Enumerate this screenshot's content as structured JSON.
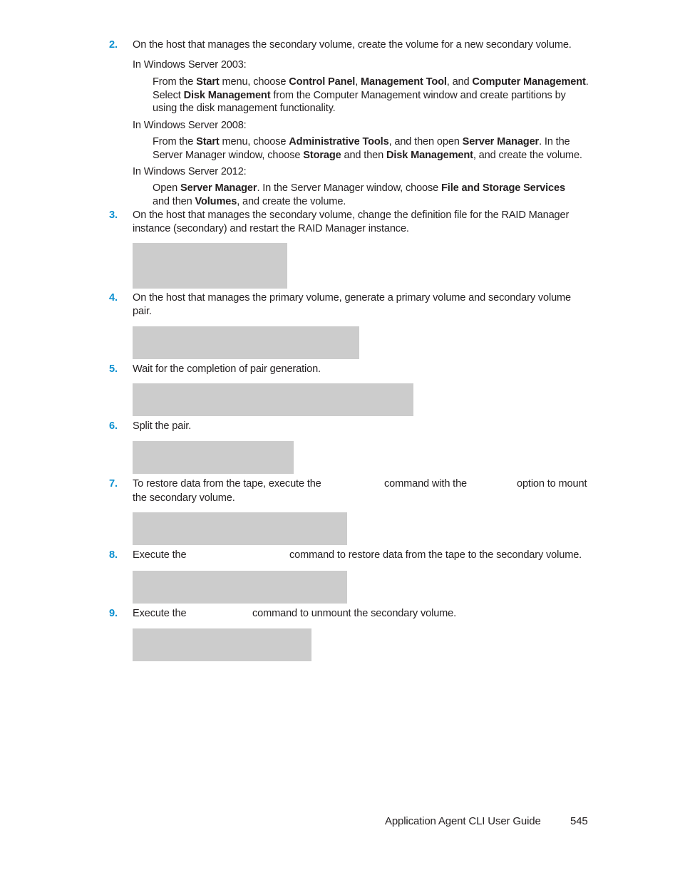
{
  "accent_color": "#0a8fd0",
  "code_block_color": "#cccccc",
  "steps": [
    {
      "number": "2.",
      "text": "On the host that manages the secondary volume, create the volume for a new secondary volume.",
      "sub": [
        {
          "heading": "In Windows Server 2003:",
          "lines": [
            {
              "parts": [
                {
                  "t": "From the "
                },
                {
                  "b": "Start"
                },
                {
                  "t": " menu, choose "
                },
                {
                  "b": "Control Panel"
                },
                {
                  "t": ", "
                },
                {
                  "b": "Management Tool"
                },
                {
                  "t": ", and "
                },
                {
                  "b": "Computer Management"
                },
                {
                  "t": "."
                }
              ]
            },
            {
              "parts": [
                {
                  "t": "Select "
                },
                {
                  "b": "Disk Management"
                },
                {
                  "t": " from the Computer Management window and create partitions by"
                }
              ]
            },
            {
              "parts": [
                {
                  "t": "using the disk management functionality."
                }
              ]
            }
          ]
        },
        {
          "heading": "In Windows Server 2008:",
          "lines": [
            {
              "parts": [
                {
                  "t": "From the "
                },
                {
                  "b": "Start"
                },
                {
                  "t": " menu, choose "
                },
                {
                  "b": "Administrative Tools"
                },
                {
                  "t": ", and then open "
                },
                {
                  "b": "Server Manager"
                },
                {
                  "t": ". In the"
                }
              ]
            },
            {
              "parts": [
                {
                  "t": "Server Manager window, choose "
                },
                {
                  "b": "Storage"
                },
                {
                  "t": " and then "
                },
                {
                  "b": "Disk Management"
                },
                {
                  "t": ", and create the volume."
                }
              ]
            }
          ]
        },
        {
          "heading": "In Windows Server 2012:",
          "lines": [
            {
              "parts": [
                {
                  "t": "Open "
                },
                {
                  "b": "Server Manager"
                },
                {
                  "t": ". In the Server Manager window, choose "
                },
                {
                  "b": "File and Storage Services"
                }
              ]
            },
            {
              "parts": [
                {
                  "t": "and then "
                },
                {
                  "b": "Volumes"
                },
                {
                  "t": ", and create the volume."
                }
              ]
            }
          ]
        }
      ]
    },
    {
      "number": "3.",
      "lines": [
        "On the host that manages the secondary volume, change the definition file for the RAID Manager",
        "instance (secondary) and restart the RAID Manager instance."
      ]
    },
    {
      "number": "4.",
      "lines": [
        "On the host that manages the primary volume, generate a primary volume and secondary volume",
        "pair."
      ]
    },
    {
      "number": "5.",
      "lines": [
        "Wait for the completion of pair generation."
      ]
    },
    {
      "number": "6.",
      "lines": [
        "Split the pair."
      ]
    },
    {
      "number": "7.",
      "segments": [
        "To restore data from the tape, execute the",
        "command with the",
        "option to mount"
      ],
      "lines": [
        "the secondary volume."
      ]
    },
    {
      "number": "8.",
      "segments": [
        "Execute the",
        "command to restore data from the tape to the secondary volume."
      ]
    },
    {
      "number": "9.",
      "segments": [
        "Execute the",
        "command to unmount the secondary volume."
      ]
    }
  ],
  "footer": {
    "title": "Application Agent CLI User Guide",
    "page_number": "545"
  }
}
